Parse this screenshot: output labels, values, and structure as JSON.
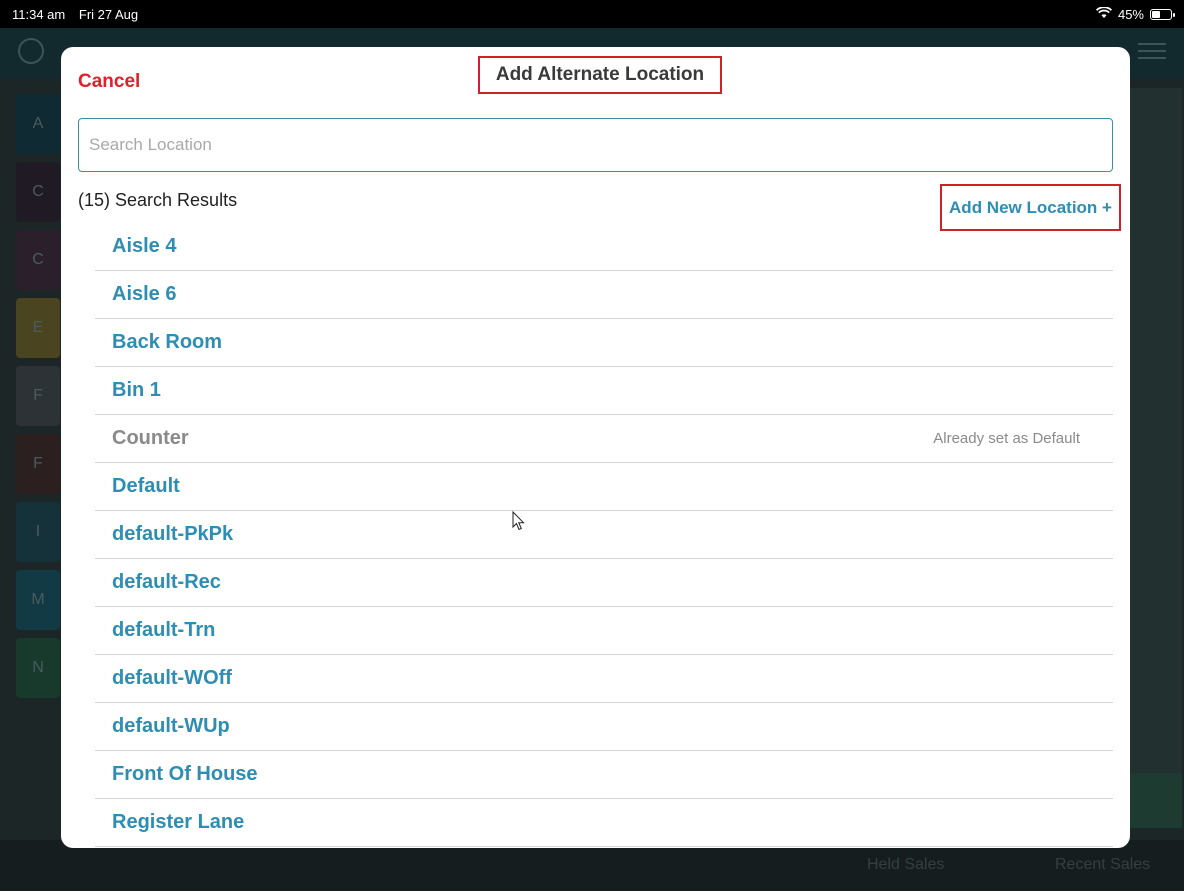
{
  "status_bar": {
    "time": "11:34 am",
    "date": "Fri 27 Aug",
    "battery": "45%",
    "wifi_icon": "wifi-icon"
  },
  "background": {
    "tile_letters": [
      "A",
      "C",
      "C",
      "E",
      "F",
      "F",
      "I",
      "M",
      "N"
    ],
    "bottom_labels": [
      "Held Sales",
      "Recent Sales"
    ]
  },
  "modal": {
    "cancel_label": "Cancel",
    "title": "Add Alternate Location",
    "search_placeholder": "Search Location",
    "search_value": "",
    "results_count": "(15) Search Results",
    "add_new_label": "Add New Location +",
    "items": [
      {
        "label": "Aisle 4",
        "disabled": false,
        "note": ""
      },
      {
        "label": "Aisle 6",
        "disabled": false,
        "note": ""
      },
      {
        "label": "Back Room",
        "disabled": false,
        "note": ""
      },
      {
        "label": "Bin 1",
        "disabled": false,
        "note": ""
      },
      {
        "label": "Counter",
        "disabled": true,
        "note": "Already set as Default"
      },
      {
        "label": "Default",
        "disabled": false,
        "note": ""
      },
      {
        "label": "default-PkPk",
        "disabled": false,
        "note": ""
      },
      {
        "label": "default-Rec",
        "disabled": false,
        "note": ""
      },
      {
        "label": "default-Trn",
        "disabled": false,
        "note": ""
      },
      {
        "label": "default-WOff",
        "disabled": false,
        "note": ""
      },
      {
        "label": "default-WUp",
        "disabled": false,
        "note": ""
      },
      {
        "label": "Front Of House",
        "disabled": false,
        "note": ""
      },
      {
        "label": "Register Lane",
        "disabled": false,
        "note": ""
      }
    ]
  },
  "colors": {
    "link": "#2e8db3",
    "cancel": "#e0202a",
    "highlight_border": "#d0202a",
    "disabled": "#8a8a8a"
  }
}
